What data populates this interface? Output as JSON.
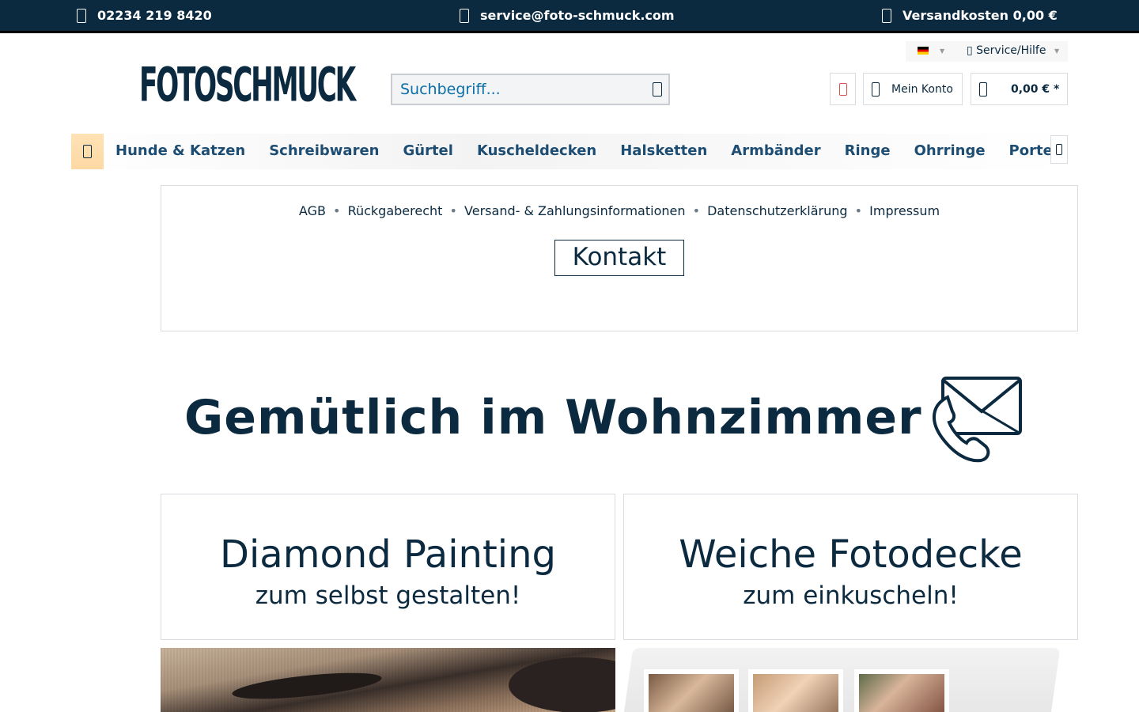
{
  "topbar": {
    "phone": "02234 219 8420",
    "email": "service@foto-schmuck.com",
    "shipping": "Versandkosten 0,00 €",
    "background": "#0b2a40"
  },
  "service": {
    "language_flag": "de-flag",
    "link_label": "Service/Hilfe"
  },
  "header": {
    "logo_text": "FOTOSCHMUCK",
    "search_placeholder": "Suchbegriff...",
    "account_label": "Mein Konto",
    "cart_total": "0,00 € *"
  },
  "nav": {
    "items": [
      "Hunde & Katzen",
      "Schreibwaren",
      "Gürtel",
      "Kuscheldecken",
      "Halsketten",
      "Armbänder",
      "Ringe",
      "Ohrringe",
      "Porte"
    ]
  },
  "info": {
    "links": [
      "AGB",
      "Rückgaberecht",
      "Versand- & Zahlungsinformationen",
      "Datenschutzerklärung",
      "Impressum"
    ],
    "separator": "•",
    "contact_button": "Kontakt"
  },
  "hero": {
    "title": "Gemütlich im Wohnzimmer"
  },
  "promos": [
    {
      "title": "Diamond Painting",
      "subtitle": "zum selbst gestalten!"
    },
    {
      "title": "Weiche Fotodecke",
      "subtitle": "zum einkuscheln!"
    }
  ],
  "colors": {
    "brand_dark": "#0b2a40",
    "nav_text": "#1d4d73",
    "link_blue": "#0b6fa8",
    "wishlist_red": "#d9534f",
    "home_accent": "#fdd8a3"
  }
}
